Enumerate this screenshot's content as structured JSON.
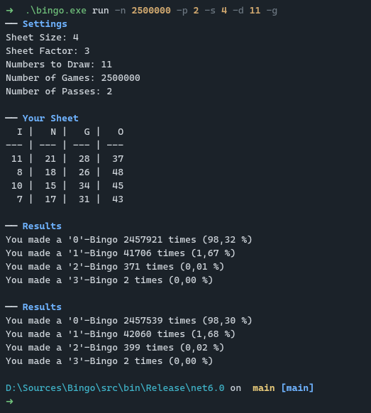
{
  "cmd": {
    "arrow": "➜",
    "exe": ".\\bingo.exe",
    "subcmd": "run",
    "flag_n": "-n",
    "val_n": "2500000",
    "flag_p": "-p",
    "val_p": "2",
    "flag_s": "-s",
    "val_s": "4",
    "flag_d": "-d",
    "val_d": "11",
    "flag_g": "-g"
  },
  "rule": "──",
  "sections": {
    "settings": "Settings",
    "sheet": "Your Sheet",
    "results": "Results"
  },
  "settings": {
    "sheet_size": "Sheet Size: 4",
    "sheet_factor": "Sheet Factor: 3",
    "numbers_to_draw": "Numbers to Draw: 11",
    "number_of_games": "Number of Games: 2500000",
    "number_of_passes": "Number of Passes: 2"
  },
  "sheet": {
    "header": "  I |   N |   G |   O",
    "divider": "--- | --- | --- | ---",
    "rows": [
      " 11 |  21 |  28 |  37",
      "  8 |  18 |  26 |  48",
      " 10 |  15 |  34 |  45",
      "  7 |  17 |  31 |  43"
    ]
  },
  "results1": [
    "You made a '0'-Bingo 2457921 times (98,32 %)",
    "You made a '1'-Bingo 41706 times (1,67 %)",
    "You made a '2'-Bingo 371 times (0,01 %)",
    "You made a '3'-Bingo 2 times (0,00 %)"
  ],
  "results2": [
    "You made a '0'-Bingo 2457539 times (98,30 %)",
    "You made a '1'-Bingo 42060 times (1,68 %)",
    "You made a '2'-Bingo 399 times (0,02 %)",
    "You made a '3'-Bingo 2 times (0,00 %)"
  ],
  "prompt": {
    "path": "D:\\Sources\\Bingo\\src\\bin\\Release\\net6.0",
    "on": " on ",
    "branch_sym": "",
    "branch_name": "main",
    "lbracket": "[",
    "tag": "main",
    "rbracket": "]"
  }
}
